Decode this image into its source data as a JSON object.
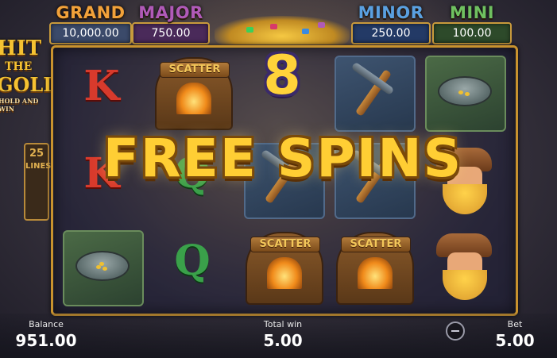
{
  "jackpots": {
    "grand": {
      "label": "GRAND",
      "value": "10,000.00"
    },
    "major": {
      "label": "MAJOR",
      "value": "750.00"
    },
    "minor": {
      "label": "MINOR",
      "value": "250.00"
    },
    "mini": {
      "label": "MINI",
      "value": "100.00"
    }
  },
  "logo": {
    "line1": "HIT",
    "line2": "THE",
    "line3": "GOLD!",
    "tagline": "HOLD AND WIN"
  },
  "lines_badge": {
    "count": "25",
    "word": "LINES"
  },
  "reels": {
    "letters": {
      "k": "K",
      "q": "Q"
    },
    "scatter_label": "SCATTER"
  },
  "banner": {
    "count": "8",
    "text": "FREE SPINS"
  },
  "footer": {
    "balance_label": "Balance",
    "balance_value": "951.00",
    "total_win_label": "Total win",
    "total_win_value": "5.00",
    "bet_label": "Bet",
    "bet_value": "5.00"
  }
}
